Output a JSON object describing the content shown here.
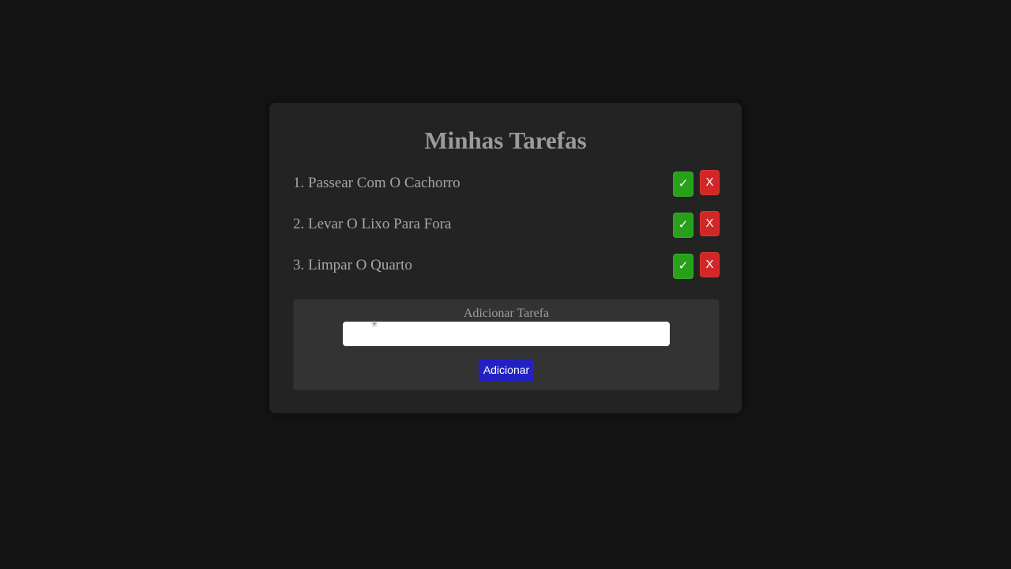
{
  "header": {
    "title": "Minhas Tarefas"
  },
  "tasks": [
    {
      "label": "1. Passear Com O Cachorro",
      "done_label": "✓",
      "delete_label": "X"
    },
    {
      "label": "2. Levar O Lixo Para Fora",
      "done_label": "✓",
      "delete_label": "X"
    },
    {
      "label": "3. Limpar O Quarto",
      "done_label": "✓",
      "delete_label": "X"
    }
  ],
  "add_form": {
    "label": "Adicionar Tarefa",
    "input_value": "",
    "button_label": "Adicionar"
  },
  "colors": {
    "background": "#141414",
    "card": "#232323",
    "done_button": "#28a11a",
    "delete_button": "#d32626",
    "add_button": "#2222c4"
  }
}
